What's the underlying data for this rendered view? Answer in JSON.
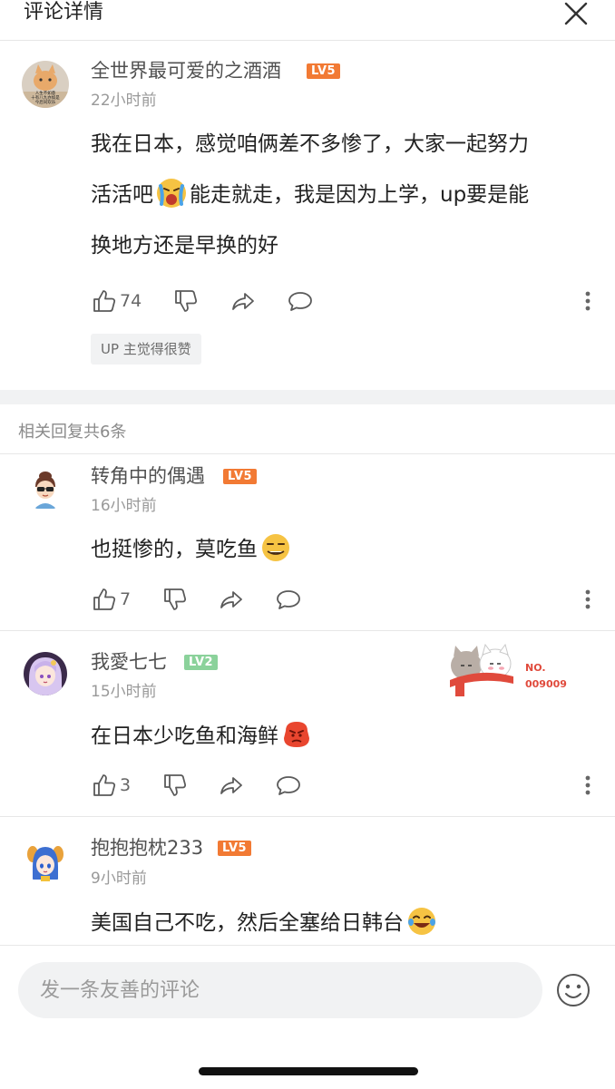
{
  "header": {
    "title": "评论详情"
  },
  "main_comment": {
    "username": "全世界最可爱的之酒酒",
    "level": "LV5",
    "time": "22小时前",
    "lines": [
      "我在日本，感觉咱俩差不多惨了，大家一起努力",
      "活活吧",
      "能走就走，我是因为上学，up要是能",
      "换地方还是早换的好"
    ],
    "likes": "74",
    "up_badge": "UP 主觉得很赞",
    "avatar_text": [
      "人生不如意",
      "十有八九亦如是",
      "今后同欢乐"
    ]
  },
  "replies_header": "相关回复共6条",
  "replies": [
    {
      "username": "转角中的偶遇",
      "level": "LV5",
      "time": "16小时前",
      "text": "也挺惨的，莫吃鱼",
      "likes": "7"
    },
    {
      "username": "我愛七七",
      "level": "LV2",
      "time": "15小时前",
      "text": "在日本少吃鱼和海鲜",
      "likes": "3",
      "sticker_text": [
        "NO.",
        "009009"
      ]
    },
    {
      "username": "抱抱抱枕233",
      "level": "LV5",
      "time": "9小时前",
      "text": "美国自己不吃，然后全塞给日韩台"
    }
  ],
  "input": {
    "placeholder": "发一条友善的评论"
  },
  "colors": {
    "level5": "#f27a34",
    "level2": "#8bd29b",
    "text_secondary": "#999999"
  },
  "icons": [
    "close-icon",
    "thumb-up-icon",
    "thumb-down-icon",
    "share-icon",
    "comment-icon",
    "more-vertical-icon",
    "emoji-icon"
  ]
}
